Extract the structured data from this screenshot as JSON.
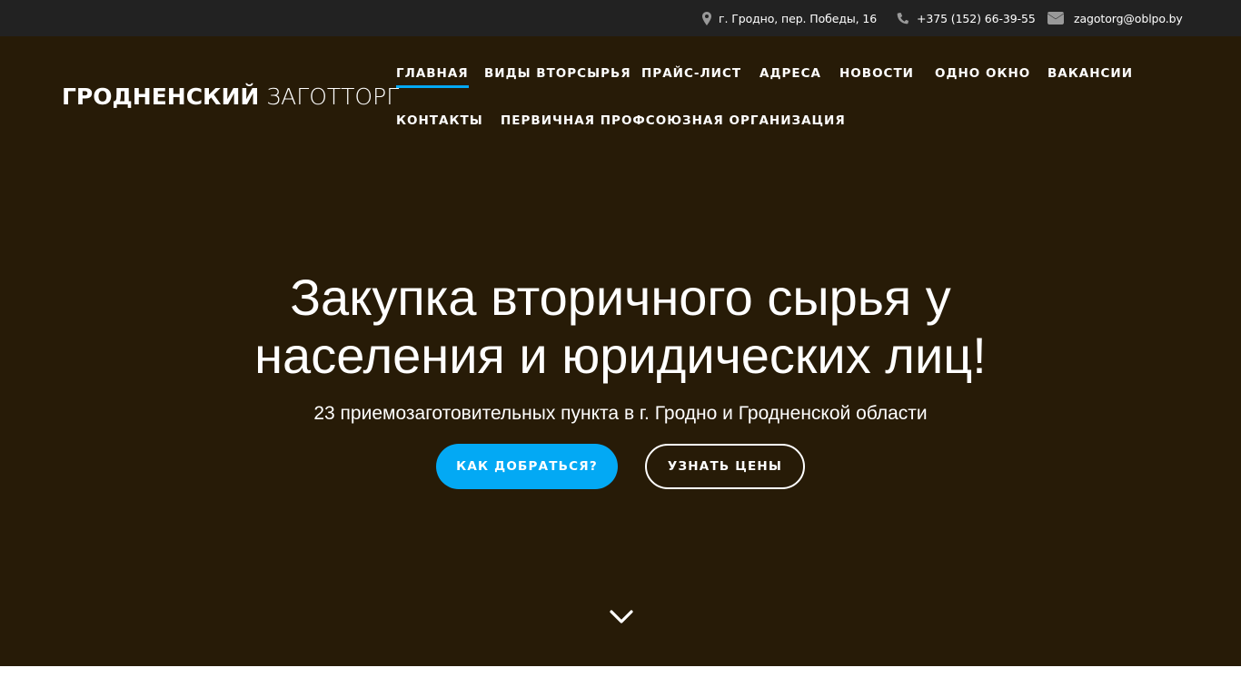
{
  "topbar": {
    "address": {
      "icon": "map-marker-icon",
      "text": "г. Гродно, пер. Победы, 16"
    },
    "phone": {
      "icon": "phone-icon",
      "text": "+375 (152) 66-39-55"
    },
    "email": {
      "icon": "envelope-icon",
      "text": "zagotorg@oblpo.by"
    }
  },
  "logo": {
    "bold": "ГРОДНЕНСКИЙ",
    "light": "ЗАГОТТОРГ"
  },
  "nav": {
    "items": [
      "ГЛАВНАЯ",
      "ВИДЫ ВТОРСЫРЬЯ",
      "ПРАЙС-ЛИСТ",
      "АДРЕСА",
      "НОВОСТИ",
      "ОДНО ОКНО",
      "ВАКАНСИИ",
      "КОНТАКТЫ",
      "ПЕРВИЧНАЯ ПРОФСОЮЗНАЯ ОРГАНИЗАЦИЯ"
    ],
    "active": "ГЛАВНАЯ"
  },
  "hero": {
    "title_line1": "Закупка вторичного сырья у",
    "title_line2": "населения и юридических лиц!",
    "subtitle": "23 приемозаготовительных пункта в г. Гродно и Гродненской области",
    "primary_button": "КАК ДОБРАТЬСЯ?",
    "secondary_button": "УЗНАТЬ ЦЕНЫ",
    "scroll_icon": "chevron-down-icon"
  },
  "colors": {
    "topbar_bg": "#222222",
    "hero_bg": "#271b07",
    "accent": "#03a9f4",
    "icon_gray": "#999999",
    "text": "#ffffff"
  }
}
